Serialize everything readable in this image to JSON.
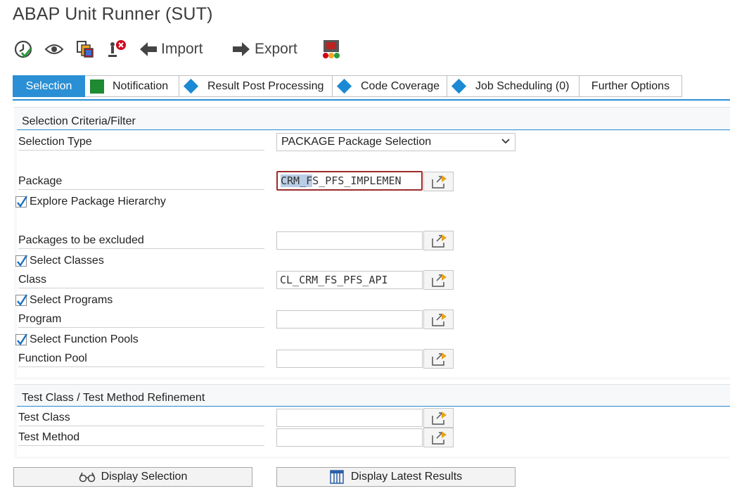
{
  "window": {
    "title": "ABAP Unit Runner (SUT)"
  },
  "toolbar": {
    "import_label": "Import",
    "export_label": "Export",
    "icons": [
      "execute-icon",
      "display-icon",
      "copy-objects-icon",
      "delete-variant-icon",
      "arrow-left-icon",
      "arrow-right-icon",
      "traffic-light-icon"
    ]
  },
  "tabs": [
    {
      "label": "Selection",
      "active": true
    },
    {
      "label": "Notification",
      "icon": "green-square-icon"
    },
    {
      "label": "Result Post Processing",
      "icon": "blue-diamond-icon"
    },
    {
      "label": "Code Coverage",
      "icon": "blue-diamond-icon"
    },
    {
      "label": "Job Scheduling (0)",
      "icon": "blue-diamond-icon"
    },
    {
      "label": "Further Options"
    }
  ],
  "selection_group": {
    "title": "Selection Criteria/Filter",
    "selection_type_label": "Selection Type",
    "selection_type_value": "PACKAGE Package Selection",
    "package_label": "Package",
    "package_value_selected": "CRM_F",
    "package_value_rest": "S_PFS_IMPLEMEN",
    "explore_hierarchy_label": "Explore Package Hierarchy",
    "explore_hierarchy_checked": true,
    "excluded_label": "Packages to be excluded",
    "excluded_value": "",
    "select_classes_label": "Select Classes",
    "select_classes_checked": true,
    "class_label": "Class",
    "class_value": "CL_CRM_FS_PFS_API",
    "select_programs_label": "Select Programs",
    "select_programs_checked": true,
    "program_label": "Program",
    "program_value": "",
    "select_function_pools_label": "Select Function Pools",
    "select_function_pools_checked": true,
    "function_pool_label": "Function Pool",
    "function_pool_value": ""
  },
  "refinement_group": {
    "title": "Test Class / Test Method Refinement",
    "test_class_label": "Test Class",
    "test_class_value": "",
    "test_method_label": "Test Method",
    "test_method_value": ""
  },
  "footer": {
    "display_selection_label": "Display Selection",
    "display_latest_results_label": "Display Latest Results"
  },
  "colors": {
    "accent": "#2a8fd4",
    "focus_border": "#9b2c2c",
    "multi_select_arrow": "#e8a317"
  }
}
